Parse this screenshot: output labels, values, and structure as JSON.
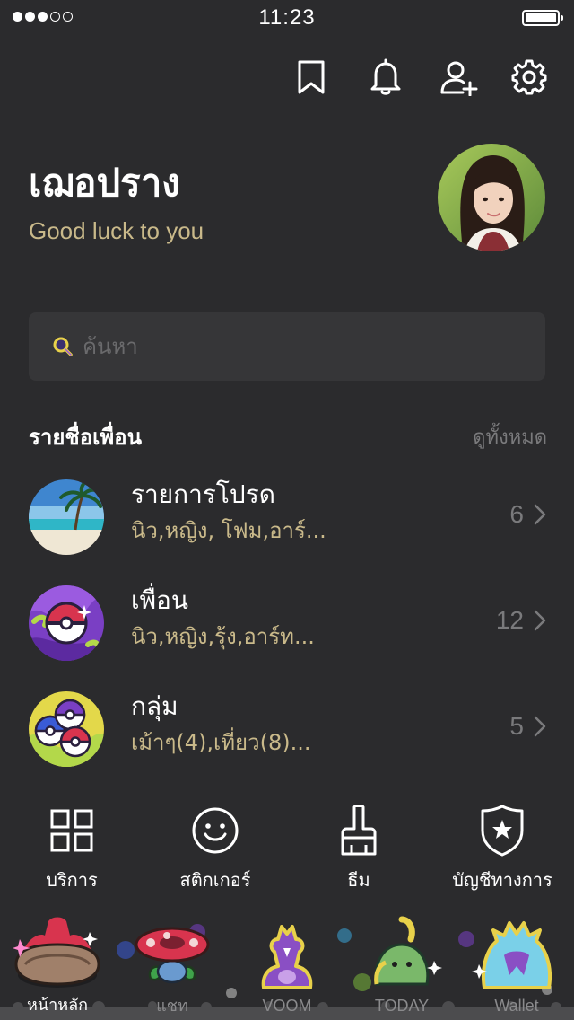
{
  "status_bar": {
    "time": "11:23",
    "signal_bars_filled": 3,
    "signal_bars_total": 5
  },
  "top_actions": [
    {
      "icon": "bookmark-icon"
    },
    {
      "icon": "bell-icon"
    },
    {
      "icon": "add-friend-icon"
    },
    {
      "icon": "gear-icon"
    }
  ],
  "profile": {
    "name": "เฌอปราง",
    "status_message": "Good luck to you"
  },
  "search": {
    "placeholder": "ค้นหา"
  },
  "friends_section": {
    "title": "รายชื่อเพื่อน",
    "see_all": "ดูทั้งหมด",
    "rows": [
      {
        "title": "รายการโปรด",
        "subtitle": "นิว,หญิง, โฟม,อาร์...",
        "count": "6"
      },
      {
        "title": "เพื่อน",
        "subtitle": "นิว,หญิง,รุ้ง,อาร์ท...",
        "count": "12"
      },
      {
        "title": "กลุ่ม",
        "subtitle": "เม้าๆ(4),เที่ยว(8)...",
        "count": "5"
      }
    ]
  },
  "quick_menu": [
    {
      "label": "บริการ",
      "icon": "grid-icon"
    },
    {
      "label": "สติกเกอร์",
      "icon": "smiley-icon"
    },
    {
      "label": "ธีม",
      "icon": "brush-icon"
    },
    {
      "label": "บัญชีทางการ",
      "icon": "shield-star-icon"
    }
  ],
  "tab_bar": [
    {
      "label": "หน้าหลัก",
      "active": true
    },
    {
      "label": "แชท",
      "active": false
    },
    {
      "label": "VOOM",
      "active": false
    },
    {
      "label": "TODAY",
      "active": false
    },
    {
      "label": "Wallet",
      "active": false
    }
  ],
  "colors": {
    "background": "#2b2b2d",
    "accent_gold": "#c9b98a",
    "search_bg": "#363638",
    "muted_text": "#7a7a7c"
  }
}
